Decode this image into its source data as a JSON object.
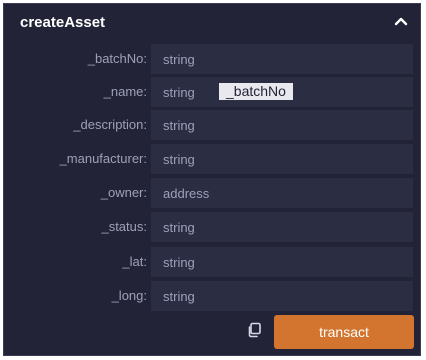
{
  "function_panel": {
    "title": "createAsset",
    "params": [
      {
        "label": "_batchNo:",
        "placeholder": "string"
      },
      {
        "label": "_name:",
        "placeholder": "string"
      },
      {
        "label": "_description:",
        "placeholder": "string"
      },
      {
        "label": "_manufacturer:",
        "placeholder": "string"
      },
      {
        "label": "_owner:",
        "placeholder": "address"
      },
      {
        "label": "_status:",
        "placeholder": "string"
      },
      {
        "label": "_lat:",
        "placeholder": "string"
      },
      {
        "label": "_long:",
        "placeholder": "string"
      }
    ],
    "tooltip": "_batchNo",
    "transact_label": "transact"
  },
  "colors": {
    "panel_bg": "#222336",
    "field_bg": "#2b2d43",
    "label": "#9ea0ba",
    "accent": "#d3752e"
  },
  "icons": {
    "collapse": "chevron-up-icon",
    "copy": "copy-icon"
  }
}
